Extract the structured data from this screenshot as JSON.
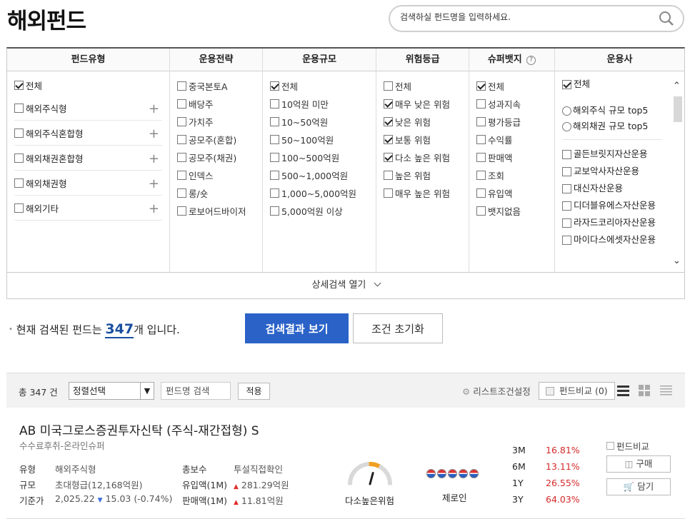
{
  "page": {
    "title": "해외펀드"
  },
  "search": {
    "placeholder": "검색하실 펀드명을 입력하세요."
  },
  "filters": {
    "fund_type": {
      "header": "펀드유형",
      "items": [
        {
          "label": "전체",
          "checked": true
        },
        {
          "label": "해외주식형",
          "checked": false
        },
        {
          "label": "해외주식혼합형",
          "checked": false
        },
        {
          "label": "해외채권혼합형",
          "checked": false
        },
        {
          "label": "해외채권형",
          "checked": false
        },
        {
          "label": "해외기타",
          "checked": false
        }
      ]
    },
    "strategy": {
      "header": "운용전략",
      "items": [
        {
          "label": "중국본토A",
          "checked": false
        },
        {
          "label": "배당주",
          "checked": false
        },
        {
          "label": "가치주",
          "checked": false
        },
        {
          "label": "공모주(혼합)",
          "checked": false
        },
        {
          "label": "공모주(채권)",
          "checked": false
        },
        {
          "label": "인덱스",
          "checked": false
        },
        {
          "label": "롱/숏",
          "checked": false
        },
        {
          "label": "로보어드바이저",
          "checked": false
        }
      ]
    },
    "size": {
      "header": "운용규모",
      "items": [
        {
          "label": "전체",
          "checked": true
        },
        {
          "label": "10억원 미만",
          "checked": false
        },
        {
          "label": "10~50억원",
          "checked": false
        },
        {
          "label": "50~100억원",
          "checked": false
        },
        {
          "label": "100~500억원",
          "checked": false
        },
        {
          "label": "500~1,000억원",
          "checked": false
        },
        {
          "label": "1,000~5,000억원",
          "checked": false
        },
        {
          "label": "5,000억원 이상",
          "checked": false
        }
      ]
    },
    "risk": {
      "header": "위험등급",
      "items": [
        {
          "label": "전체",
          "checked": false
        },
        {
          "label": "매우 낮은 위험",
          "checked": true
        },
        {
          "label": "낮은 위험",
          "checked": true
        },
        {
          "label": "보통 위험",
          "checked": true
        },
        {
          "label": "다소 높은 위험",
          "checked": true
        },
        {
          "label": "높은 위험",
          "checked": false
        },
        {
          "label": "매우 높은 위험",
          "checked": false
        }
      ]
    },
    "super_badge": {
      "header": "슈퍼뱃지",
      "help": "?",
      "items": [
        {
          "label": "전체",
          "checked": true
        },
        {
          "label": "성과지속",
          "checked": false
        },
        {
          "label": "평가등급",
          "checked": false
        },
        {
          "label": "수익률",
          "checked": false
        },
        {
          "label": "판매액",
          "checked": false
        },
        {
          "label": "조회",
          "checked": false
        },
        {
          "label": "유입액",
          "checked": false
        },
        {
          "label": "뱃지없음",
          "checked": false
        }
      ]
    },
    "company": {
      "header": "운용사",
      "all": {
        "label": "전체",
        "checked": true
      },
      "radios": [
        "해외주식 규모 top5",
        "해외채권 규모 top5"
      ],
      "items": [
        "골든브릿지자산운용",
        "교보악사자산운용",
        "대신자산운용",
        "디더블유에스자산운용",
        "라자드코리아자산운용",
        "마이다스에셋자산운용"
      ]
    },
    "detail_toggle": "상세검색 열기"
  },
  "result": {
    "prefix": "현재 검색된 펀드는",
    "count": "347",
    "suffix": "개 입니다.",
    "search_button": "검색결과 보기",
    "reset_button": "조건 초기화"
  },
  "toolbar": {
    "total": "총 347 건",
    "sort_select": "정렬선택",
    "name_search_placeholder": "펀드명 검색",
    "apply": "적용",
    "list_settings": "리스트조건설정",
    "compare": "펀드비교 (0)"
  },
  "fund": {
    "name": "AB 미국그로스증권투자신탁 (주식-재간접형) S",
    "subtitle": "수수료후취-온라인슈퍼",
    "type_label": "유형",
    "type_value": "해외주식형",
    "size_label": "규모",
    "size_value": "초대형급(12,168억원)",
    "nav_label": "기준가",
    "nav_value": "2,025.22",
    "nav_change": "15.03",
    "nav_pct": "(-0.74%)",
    "fee_label": "총보수",
    "fee_value": "투설직접확인",
    "inflow_label": "유입액(1M)",
    "inflow_value": "281.29억원",
    "sales_label": "판매액(1M)",
    "sales_value": "11.81억원",
    "risk_text": "다소높은위험",
    "risk_level": 4,
    "risk_levels": 6,
    "rating_text": "제로인",
    "rating_badges": 5,
    "returns": [
      {
        "period": "3M",
        "value": "16.81%"
      },
      {
        "period": "6M",
        "value": "13.11%"
      },
      {
        "period": "1Y",
        "value": "26.55%"
      },
      {
        "period": "3Y",
        "value": "64.03%"
      }
    ],
    "compare_label": "펀드비교",
    "buy_label": "구매",
    "cart_label": "담기"
  }
}
